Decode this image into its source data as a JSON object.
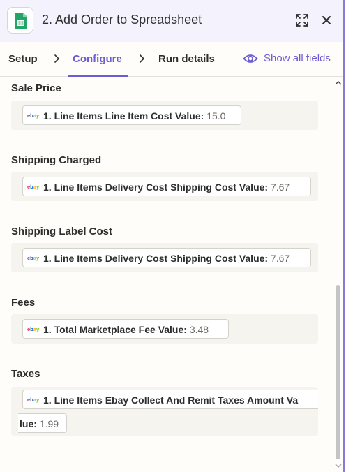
{
  "header": {
    "step_number": "2.",
    "title": "Add Order to Spreadsheet",
    "app_icon": "google-sheets-icon",
    "expand_icon": "expand-icon",
    "close_icon": "close-icon"
  },
  "tabs": {
    "setup": "Setup",
    "configure": "Configure",
    "run_details": "Run details",
    "active": "Configure",
    "show_all_fields": "Show all fields",
    "accent_color": "#6b5cd3"
  },
  "fields": [
    {
      "label": "Sale Price",
      "pill_key": "1. Line Items Line Item Cost Value:",
      "pill_value": "15.0",
      "source_icon": "ebay-icon"
    },
    {
      "label": "Shipping Charged",
      "pill_key": "1. Line Items Delivery Cost Shipping Cost Value:",
      "pill_value": "7.67",
      "source_icon": "ebay-icon"
    },
    {
      "label": "Shipping Label Cost",
      "pill_key": "1. Line Items Delivery Cost Shipping Cost Value:",
      "pill_value": "7.67",
      "source_icon": "ebay-icon"
    },
    {
      "label": "Fees",
      "pill_key": "1. Total Marketplace Fee Value:",
      "pill_value": "3.48",
      "source_icon": "ebay-icon"
    },
    {
      "label": "Taxes",
      "pill_key_line1": "1. Line Items Ebay Collect And Remit Taxes Amount Va",
      "pill_key_line2": "lue:",
      "pill_value": "1.99",
      "source_icon": "ebay-icon"
    }
  ]
}
